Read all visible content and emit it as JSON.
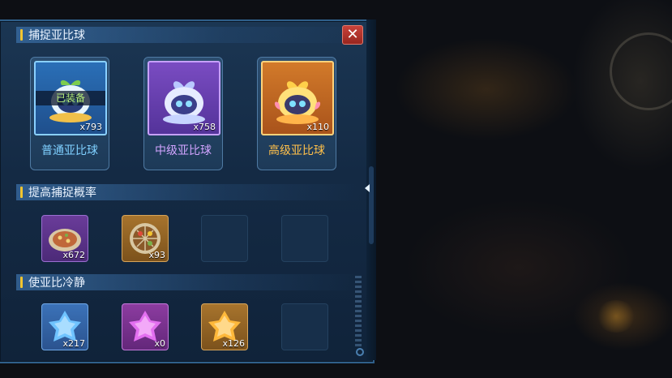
{
  "panel": {
    "sections": [
      {
        "title": "捕捉亚比球"
      },
      {
        "title": "提高捕捉概率"
      },
      {
        "title": "使亚比冷静"
      }
    ],
    "close_label": "✕"
  },
  "balls": [
    {
      "name": "普通亚比球",
      "count": "x793",
      "badge": "已装备"
    },
    {
      "name": "中级亚比球",
      "count": "x758"
    },
    {
      "name": "高级亚比球",
      "count": "x110"
    }
  ],
  "capture_items": [
    {
      "count": "x672",
      "icon": "pizza-platter-icon"
    },
    {
      "count": "x93",
      "icon": "food-platter-icon"
    }
  ],
  "calm_items": [
    {
      "count": "x217",
      "icon": "blue-jelly-icon"
    },
    {
      "count": "x0",
      "icon": "pink-jelly-icon"
    },
    {
      "count": "x126",
      "icon": "orange-jelly-icon"
    }
  ],
  "colors": {
    "panel_bg": "#142a44",
    "header_accent": "#f2c530",
    "common": "#7fd0ff",
    "mid": "#d1a4ff",
    "high": "#ffc04a",
    "close": "#c9423a"
  }
}
